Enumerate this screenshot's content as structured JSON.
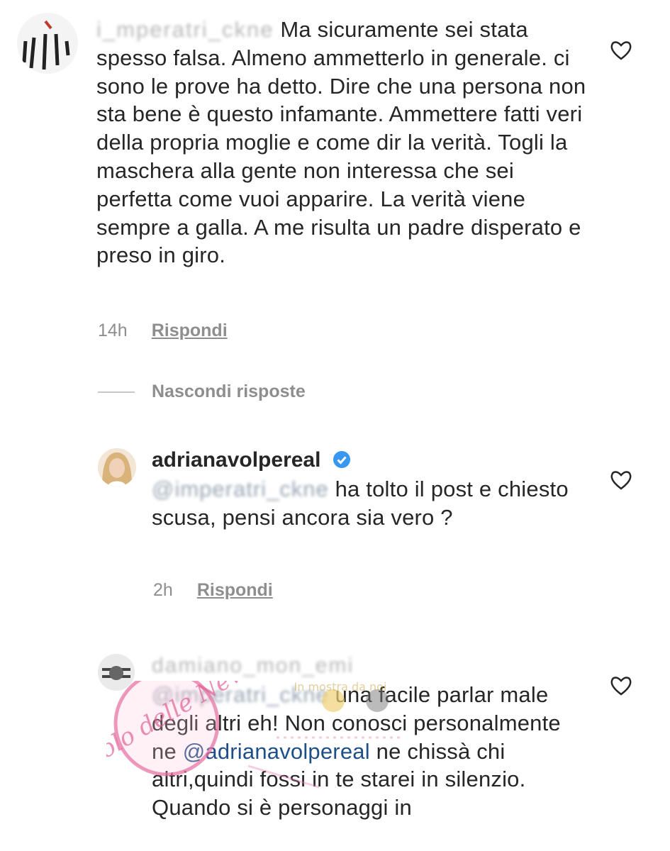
{
  "comments": [
    {
      "username_blurred": "i_mperatri_ckne",
      "text_main": "Ma sicuramente sei stata spesso falsa. Almeno ammetterlo in generale. ci sono le prove ha detto. Dire che una persona non sta bene è questo infamante. Ammettere fatti veri della propria moglie e come dir la verità. Togli la maschera alla gente non interessa che sei perfetta come vuoi apparire. La verità viene sempre a galla. A me risulta un padre disperato e preso in giro.",
      "time": "14h",
      "reply_label": "Rispondi"
    }
  ],
  "hide_replies_label": "Nascondi risposte",
  "replies": [
    {
      "username": "adrianavolpereal",
      "mention_blurred": "@imperatri_ckne",
      "text": "ha tolto il post e chiesto scusa, pensi ancora sia vero ?",
      "time": "2h",
      "reply_label": "Rispondi"
    },
    {
      "username_blurred": "damiano_mon_emi",
      "mention_blurred": "@imperatri_ckne",
      "text_part1": "una facile parlar male degli altri eh! Non conosci personalmente ne",
      "mention2": "@adrianavolpereal",
      "text_part2": "ne chissà chi altri,quindi fossi in te starei in silenzio. Quando si è personaggi in"
    }
  ],
  "watermark": {
    "text_left": "Vicolo delle News",
    "text_right": "In mostra da noi"
  },
  "colors": {
    "text": "#262626",
    "muted": "#8e8e8e",
    "mention": "#1f4f87",
    "verified": "#3897f0"
  }
}
